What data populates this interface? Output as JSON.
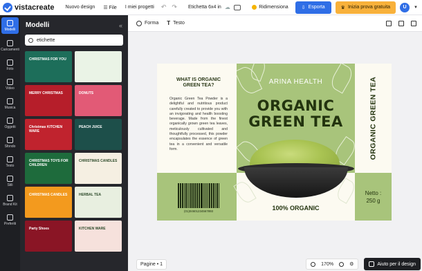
{
  "topbar": {
    "logo": "vistacreate",
    "nav": [
      "Nuovo design",
      "File",
      "I miei progetti"
    ],
    "doc_title": "Etichetta 6x4  in",
    "resize": "Ridimensiona",
    "export": "Esporta",
    "trial": "Inizia prova gratuita",
    "avatar": "U"
  },
  "rail": {
    "items": [
      "Modelli",
      "Caricamenti",
      "Foto",
      "Video",
      "Musica",
      "Oggetti",
      "Sfondo",
      "Testo",
      "Stili",
      "Brand Kit",
      "Preferiti"
    ]
  },
  "panel": {
    "title": "Modelli",
    "search_value": "etichette",
    "thumbs": [
      {
        "text": "CHRISTMAS FOR YOU",
        "bg": "#1d6e5a"
      },
      {
        "text": "",
        "bg": "#eaf3e6"
      },
      {
        "text": "MERRY CHRISTMAS",
        "bg": "#b61e2a"
      },
      {
        "text": "DONUTS",
        "bg": "#e25a76"
      },
      {
        "text": "Christmas KITCHEN WARE",
        "bg": "#c0232e"
      },
      {
        "text": "PEACH JUICE",
        "bg": "#1d4f4a"
      },
      {
        "text": "CHRISTMAS TOYS FOR CHILDREN",
        "bg": "#1e6b3c"
      },
      {
        "text": "CHRISTMAS CANDLES",
        "bg": "#f5efe2"
      },
      {
        "text": "CHRISTMAS CANDLES",
        "bg": "#f39a1e"
      },
      {
        "text": "HERBAL TEA",
        "bg": "#e8efe0"
      },
      {
        "text": "Party Shoes",
        "bg": "#8a1525"
      },
      {
        "text": "KITCHEN WARE",
        "bg": "#f6e1dc"
      }
    ]
  },
  "subbar": {
    "shapes": "Forma",
    "text": "Testo"
  },
  "label": {
    "left_heading": "WHAT IS ORGANIC GREEN TEA?",
    "left_body": "Organic Green Tea Powder is a delightful and nutritious product carefully created to provide you with an invigorating and health boosting beverage. Made from the finest organically grown green tea leaves, meticulously cultivated and thoughtfully processed, this powder encapsulates the essence of green tea in a convenient and versatile form.",
    "barcode_number": "(01)04601234567893",
    "brand": "ARINA HEALTH",
    "title_line1": "ORGANIC",
    "title_line2": "GREEN TEA",
    "badge": "100% ORGANIC",
    "vertical": "ORGANIC GREEN TEA",
    "netto_line1": "Netto :",
    "netto_line2": "250 g",
    "colors": {
      "green": "#a8c47b",
      "cream": "#fcfaf1",
      "dark": "#23340f"
    }
  },
  "bottombar": {
    "pages": "Pagine • 1",
    "zoom": "170%",
    "help": "Aiuto per il design"
  }
}
